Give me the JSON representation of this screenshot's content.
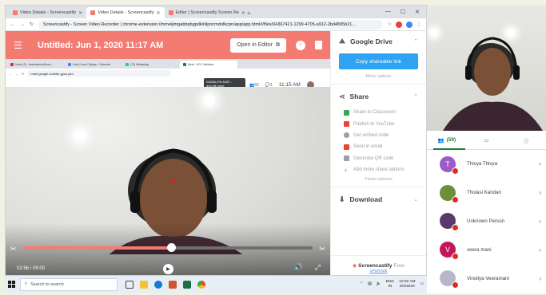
{
  "outer_tab": "New Tab",
  "chrome": {
    "tabs": [
      {
        "label": "Video Details - Screencastify",
        "color": "#f47b72",
        "active": false
      },
      {
        "label": "Video Details - Screencastify",
        "color": "#f47b72",
        "active": true
      },
      {
        "label": "Editor | Screencastify Screen Re",
        "color": "#f47b72",
        "active": false
      }
    ],
    "url": "Screencastify - Screen Video Recorder | chrome-extension://mmeijimgabbpbgpdklnllpncmdofkcpn/app/app.html#/files/04367421-1299-4705-a912-2bd4805b21..."
  },
  "recorder": {
    "title": "Untitled: Jun 1, 2020 11:17 AM",
    "open_editor_label": "Open in Editor",
    "inner_browser": {
      "tabs": [
        {
          "label": "Inbox (3) - teachadmin@rcm...",
          "color": "#d93025"
        },
        {
          "label": "Holy Cross College - Calendar",
          "color": "#4285f4"
        },
        {
          "label": "(73) WhatsApp",
          "color": "#25d366"
        },
        {
          "label": "Meet - DCC Webinar",
          "color": "#188038"
        }
      ],
      "url": "meet.google.com/tiu-gyzu-jxm",
      "presenter_name": "KAMALIYA KAR...",
      "presenter_more": "and 48 more",
      "participant_count": "60",
      "chat_count": "1",
      "clock": "11:15 AM"
    },
    "player": {
      "progress": 0.51,
      "time_label": "02:56 / 05:00"
    },
    "panel": {
      "drive_heading": "Google Drive",
      "copy_link_label": "Copy shareable link",
      "more_options_label": "More options",
      "share_heading": "Share",
      "share_items": [
        {
          "label": "Share to Classroom",
          "color": "#34a853"
        },
        {
          "label": "Publish to YouTube",
          "color": "#ea4335"
        },
        {
          "label": "Get embed code",
          "color": "#9aa0a6"
        },
        {
          "label": "Send in email",
          "color": "#ea4335"
        },
        {
          "label": "Generate QR code",
          "color": "#9aa0a6"
        },
        {
          "label": "Add more share options",
          "color": "#9aa0a6"
        }
      ],
      "fewer_options_label": "Fewer options",
      "download_heading": "Download",
      "brand": "Screencastify",
      "brand_tier": "Free",
      "upgrade_label": "UPGRADE"
    }
  },
  "taskbar": {
    "search_placeholder": "Search to search",
    "apps": [
      {
        "name": "task-view",
        "color": "#444"
      },
      {
        "name": "file-explorer",
        "color": "#f3c339"
      },
      {
        "name": "edge",
        "color": "#0f7bd1"
      },
      {
        "name": "powerpoint",
        "color": "#d35230"
      },
      {
        "name": "excel",
        "color": "#1d6f42"
      },
      {
        "name": "chrome",
        "color": "#ea4335"
      }
    ],
    "lang": "ENG",
    "region": "IN",
    "time": "10:02 AM",
    "date": "6/4/2020"
  },
  "meet_panel": {
    "people_count": "(59)",
    "participants": [
      {
        "name": "Thivya Thivya",
        "initial": "T",
        "color": "#9b5bc8"
      },
      {
        "name": "Thulasi Kandan",
        "initial": "",
        "color": "#6d8f3a"
      },
      {
        "name": "Unknown Person",
        "initial": "",
        "color": "#5b3a6b"
      },
      {
        "name": "veera mani",
        "initial": "V",
        "color": "#c2185b"
      },
      {
        "name": "Vinoliya Veeramani",
        "initial": "",
        "color": "#b7b7c9"
      }
    ]
  }
}
